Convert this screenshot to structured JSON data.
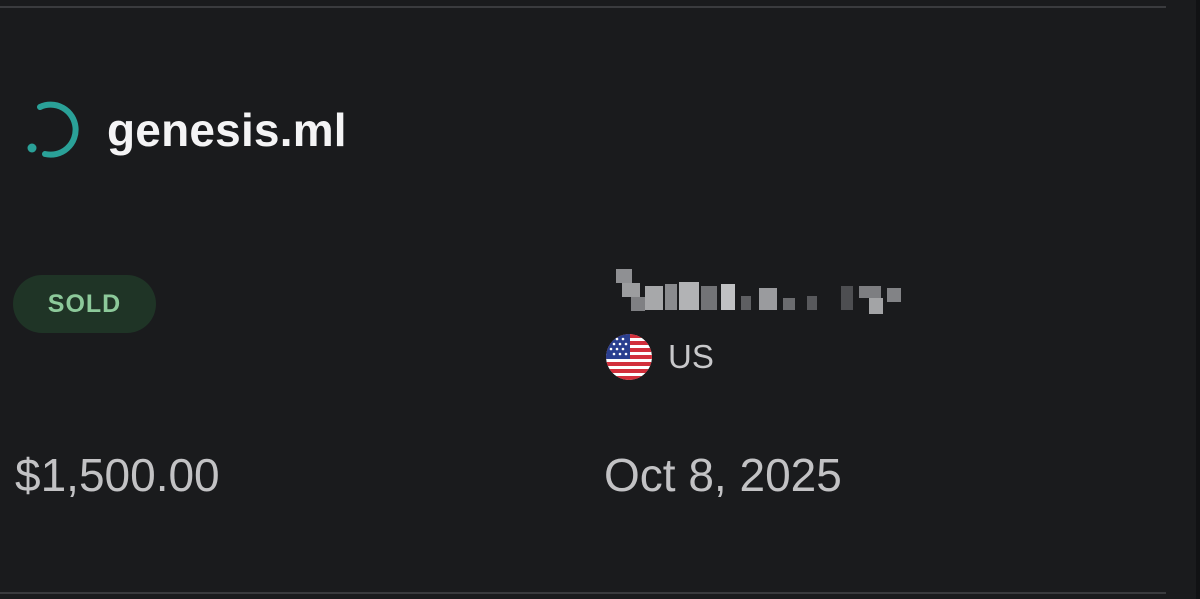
{
  "listing": {
    "domain": "genesis.ml",
    "status": "SOLD",
    "price": "$1,500.00",
    "date": "Oct 8, 2025"
  },
  "buyer": {
    "name_state": "pixelated",
    "country_code": "US",
    "flag_icon": "us-flag-icon"
  },
  "colors": {
    "background": "#1a1b1d",
    "accent": "#2aa198",
    "status_bg": "#1f3426",
    "status_text": "#8cc99a",
    "text_primary": "#f4f4f5",
    "text_secondary": "#c2c2c4"
  },
  "icons": {
    "logo": "genesis-logo-icon"
  }
}
